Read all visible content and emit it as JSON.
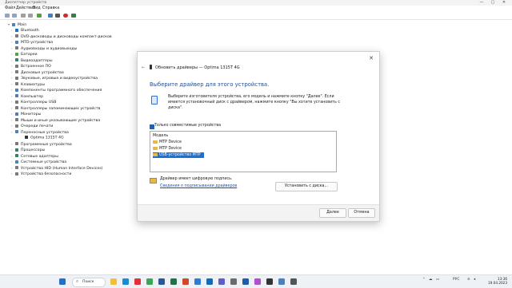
{
  "window": {
    "title": "Диспетчер устройств",
    "controls": [
      "—",
      "▢",
      "✕"
    ]
  },
  "menu": [
    "Файл",
    "Действие",
    "Вид",
    "Справка"
  ],
  "toolbar_icons": [
    "back-icon",
    "forward-icon",
    "properties-icon",
    "help-icon",
    "update-driver-icon",
    "scan-icon",
    "disable-icon",
    "uninstall-icon"
  ],
  "tree": {
    "root": "Main",
    "items": [
      {
        "label": "Bluetooth",
        "color": "#1f6fd1"
      },
      {
        "label": "DVD-дисководы и дисководы компакт-дисков",
        "color": "#7a7a7a"
      },
      {
        "label": "MTD-устройства",
        "color": "#4a7fc1"
      },
      {
        "label": "Аудиовходы и аудиовыходы",
        "color": "#7a7a7a"
      },
      {
        "label": "Батареи",
        "color": "#5aa13a"
      },
      {
        "label": "Видеоадаптеры",
        "color": "#3a7f6a"
      },
      {
        "label": "Встроенное ПО",
        "color": "#7a7a7a"
      },
      {
        "label": "Дисковые устройства",
        "color": "#7a7a7a"
      },
      {
        "label": "Звуковые, игровые и видеоустройства",
        "color": "#7a7a7a"
      },
      {
        "label": "Клавиатуры",
        "color": "#7a7a7a"
      },
      {
        "label": "Компоненты программного обеспечения",
        "color": "#4a7fc1"
      },
      {
        "label": "Компьютер",
        "color": "#4a7fc1"
      },
      {
        "label": "Контроллеры USB",
        "color": "#7a7a7a"
      },
      {
        "label": "Контроллеры запоминающих устройств",
        "color": "#7a7a7a"
      },
      {
        "label": "Мониторы",
        "color": "#4a7fc1"
      },
      {
        "label": "Мыши и иные указывающие устройства",
        "color": "#7a7a7a"
      },
      {
        "label": "Очереди печати",
        "color": "#7a7a7a"
      },
      {
        "label": "Переносные устройства",
        "color": "#4a7fc1"
      },
      {
        "label": "Optima 1315T 4G",
        "color": "#333333",
        "child": true
      },
      {
        "label": "Программные устройства",
        "color": "#7a7a7a"
      },
      {
        "label": "Процессоры",
        "color": "#3a7f6a"
      },
      {
        "label": "Сетевые адаптеры",
        "color": "#3a7f6a"
      },
      {
        "label": "Системные устройства",
        "color": "#4a7fc1"
      },
      {
        "label": "Устройства HID (Human Interface Devices)",
        "color": "#7a7a7a"
      },
      {
        "label": "Устройства безопасности",
        "color": "#7a7a7a"
      }
    ]
  },
  "dialog": {
    "title": "Обновить драйверы — Optima 1315T 4G",
    "heading": "Выберите драйвер для этого устройства.",
    "description": "Выберите изготовителя устройства, его модель и нажмите кнопку \"Далее\". Если имеется установочный диск с драйвером, нажмите кнопку \"Вы хотите установить с диска\".",
    "compatible_label": "Только совместимые устройства",
    "compatible_checked": true,
    "list_header": "Модель",
    "models": [
      "MTP Device",
      "MTP Device",
      "USB-устройство MTP"
    ],
    "selected_index": 2,
    "signed_text": "Драйвер имеет цифровую подпись.",
    "signing_link": "Сведения о подписывании драйверов",
    "install_disk_button": "Установить с диска...",
    "next_button": "Далее",
    "cancel_button": "Отмена"
  },
  "taskbar": {
    "search_label": "Поиск",
    "apps": [
      {
        "name": "file-explorer-icon",
        "color": "#f2c037"
      },
      {
        "name": "edge-icon",
        "color": "#1a8ad4"
      },
      {
        "name": "opera-icon",
        "color": "#e0303a"
      },
      {
        "name": "chrome-icon",
        "color": "#3aa757"
      },
      {
        "name": "word-icon",
        "color": "#2b5797"
      },
      {
        "name": "excel-icon",
        "color": "#217346"
      },
      {
        "name": "powerpoint-icon",
        "color": "#d24726"
      },
      {
        "name": "store-icon",
        "color": "#2d7dd2"
      },
      {
        "name": "mail-icon",
        "color": "#0f6cbd"
      },
      {
        "name": "teams-icon",
        "color": "#5b5fc7"
      },
      {
        "name": "settings-icon",
        "color": "#6b6b6b"
      },
      {
        "name": "virtualbox-icon",
        "color": "#1d5ea8"
      },
      {
        "name": "photos-icon",
        "color": "#b04fd0"
      },
      {
        "name": "terminal-icon",
        "color": "#333333"
      },
      {
        "name": "device-manager-icon",
        "color": "#4a7fc1"
      },
      {
        "name": "camera-icon",
        "color": "#555555"
      }
    ],
    "language": "РУС",
    "time": "13:36",
    "date": "19.04.2023"
  }
}
